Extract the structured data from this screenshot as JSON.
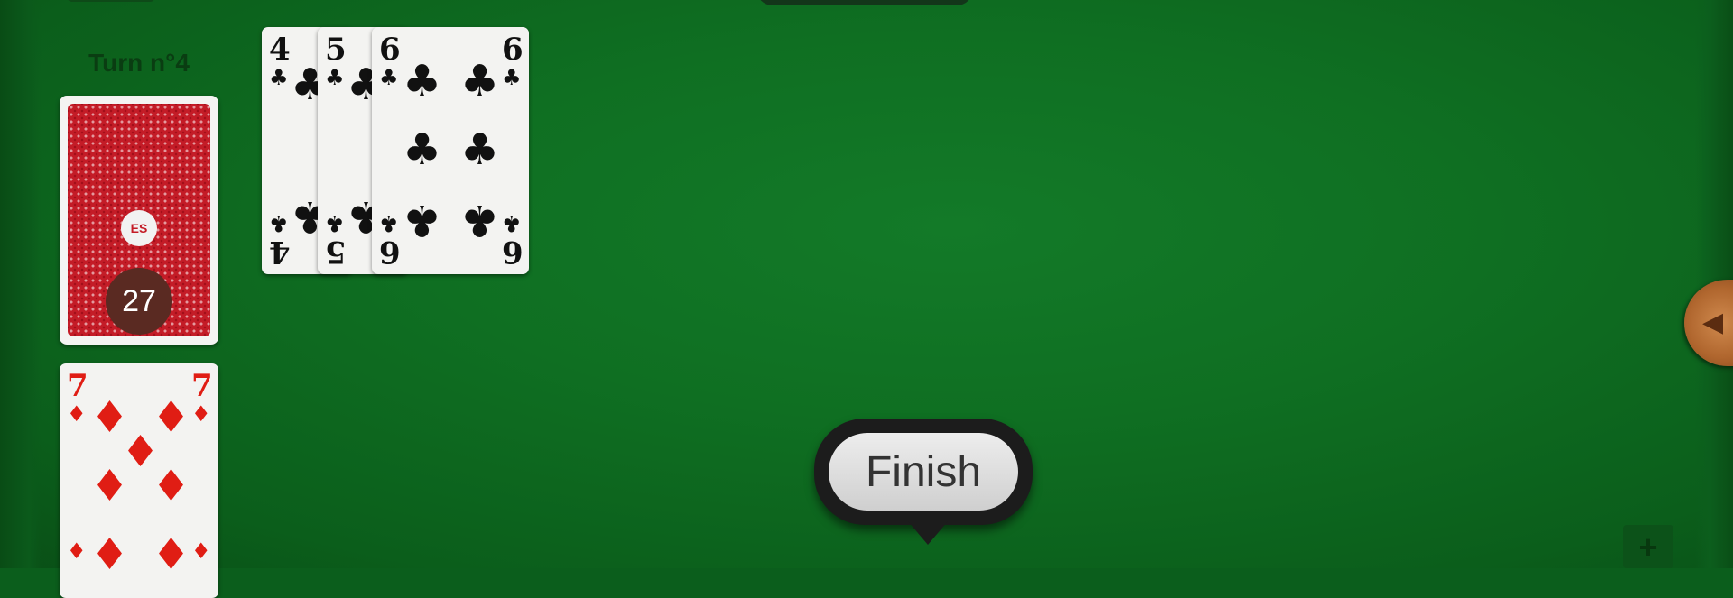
{
  "turn": {
    "label": "Turn n°4"
  },
  "deck": {
    "remaining": "27",
    "logo_text": "ES"
  },
  "cards": [
    {
      "rank": "4",
      "suit": "♣",
      "color": "black"
    },
    {
      "rank": "5",
      "suit": "♣",
      "color": "black"
    },
    {
      "rank": "6",
      "suit": "♣",
      "color": "black"
    },
    {
      "rank": "7",
      "suit": "♦",
      "color": "red"
    }
  ],
  "actions": {
    "finish_label": "Finish"
  },
  "icons": {
    "side_handle": "triangle-left-icon",
    "bottom_right": "plus-icon"
  },
  "colors": {
    "felt": "#0f6f22",
    "deck_back": "#c41c27",
    "count_badge": "#5a2a22",
    "black_suit": "#111111",
    "red_suit": "#e01d14"
  }
}
